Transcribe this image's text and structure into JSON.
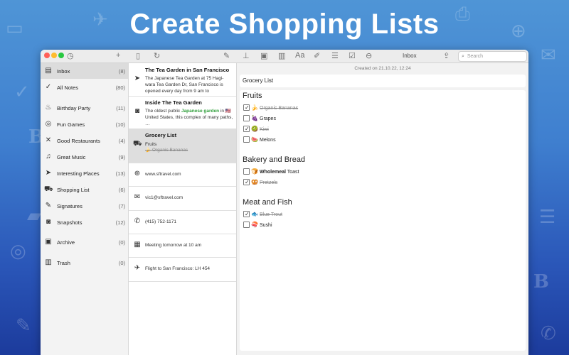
{
  "headline": "Create Shopping Lists",
  "window": {
    "title": "Inbox",
    "search_placeholder": "Search"
  },
  "sidebar": {
    "items": [
      {
        "icon": "tray-icon",
        "glyph": "▤",
        "label": "Inbox",
        "count": "(8)"
      },
      {
        "icon": "checkmark-icon",
        "glyph": "✓",
        "label": "All Notes",
        "count": "(80)"
      },
      {
        "icon": "cake-icon",
        "glyph": "♨",
        "label": "Birthday Party",
        "count": "(11)"
      },
      {
        "icon": "glasses-icon",
        "glyph": "◎",
        "label": "Fun Games",
        "count": "(10)"
      },
      {
        "icon": "fork-knife-icon",
        "glyph": "✕",
        "label": "Good Restaurants",
        "count": "(4)"
      },
      {
        "icon": "music-note-icon",
        "glyph": "♫",
        "label": "Great Music",
        "count": "(9)"
      },
      {
        "icon": "location-arrow-icon",
        "glyph": "➤",
        "label": "Interesting Places",
        "count": "(13)"
      },
      {
        "icon": "cart-icon",
        "glyph": "⛟",
        "label": "Shopping List",
        "count": "(6)"
      },
      {
        "icon": "pen-icon",
        "glyph": "✎",
        "label": "Signatures",
        "count": "(7)"
      },
      {
        "icon": "camera-icon",
        "glyph": "◙",
        "label": "Snapshots",
        "count": "(12)"
      },
      {
        "icon": "archive-icon",
        "glyph": "▣",
        "label": "Archive",
        "count": "(0)"
      },
      {
        "icon": "trash-icon",
        "glyph": "▥",
        "label": "Trash",
        "count": "(0)"
      }
    ]
  },
  "notes": [
    {
      "icon": "location-arrow-icon",
      "glyph": "➤",
      "title": "The Tea Garden in San Francisco",
      "body": "The Japanese Tea Garden at 75 Hagi-wara Tea Garden Dr, San Francisco is opened every day from 9 am to"
    },
    {
      "icon": "camera-icon",
      "glyph": "◙",
      "title": "Inside The Tea Garden",
      "body_pre": "The oldest public ",
      "body_highlight": "Japanese garden",
      "body_post": " in 🇺🇸 United States, this complex of many paths, …"
    },
    {
      "icon": "cart-icon",
      "glyph": "⛟",
      "title": "Grocery List",
      "sub1": "Fruits",
      "sub2": "🍌 Organic Bananas"
    },
    {
      "icon": "globe-icon",
      "glyph": "⊕",
      "text": "www.sftravel.com"
    },
    {
      "icon": "envelope-icon",
      "glyph": "✉",
      "text": "vic1@sftravel.com"
    },
    {
      "icon": "phone-icon",
      "glyph": "✆",
      "text": "(415) 752-1171"
    },
    {
      "icon": "calendar-icon",
      "glyph": "▦",
      "text": "Meeting tomorrow at 10 am"
    },
    {
      "icon": "airplane-icon",
      "glyph": "✈",
      "text": "Flight to San Francisco: LH 454"
    }
  ],
  "editor": {
    "created": "Created on 21.10.22, 12:24",
    "title": "Grocery List",
    "sections": [
      {
        "heading": "Fruits",
        "items": [
          {
            "checked": true,
            "emoji": "🍌",
            "text": "Organic Bananas",
            "bold": ""
          },
          {
            "checked": false,
            "emoji": "🍇",
            "text": "Grapes",
            "bold": ""
          },
          {
            "checked": true,
            "emoji": "🥝",
            "text": "Kiwi",
            "bold": ""
          },
          {
            "checked": false,
            "emoji": "🍉",
            "text": "Melons",
            "bold": ""
          }
        ]
      },
      {
        "heading": "Bakery and Bread",
        "items": [
          {
            "checked": false,
            "emoji": "🍞",
            "text": " Toast",
            "bold": "Wholemeal"
          },
          {
            "checked": true,
            "emoji": "🥨",
            "text": "Pretzels",
            "bold": ""
          }
        ]
      },
      {
        "heading": "Meat and Fish",
        "items": [
          {
            "checked": true,
            "emoji": "🐟",
            "text": "Blue Trout",
            "bold": ""
          },
          {
            "checked": false,
            "emoji": "🍣",
            "text": "Sushi",
            "bold": ""
          }
        ]
      }
    ]
  },
  "colors": {
    "accent_green": "#2f9e3a",
    "close": "#ff5f57",
    "minimize": "#febc2e",
    "zoom": "#28c840"
  }
}
